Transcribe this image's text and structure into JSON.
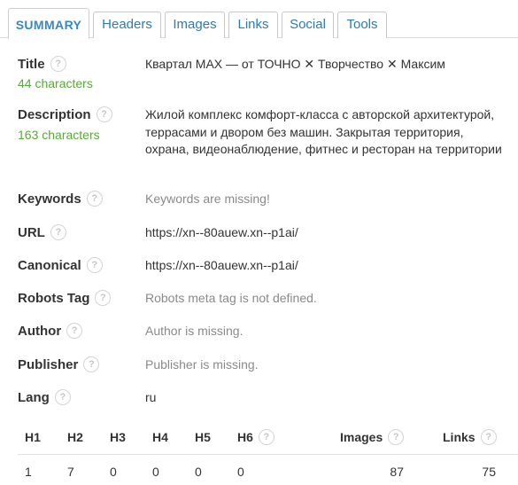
{
  "tabs": [
    {
      "label": "SUMMARY",
      "active": true
    },
    {
      "label": "Headers",
      "active": false
    },
    {
      "label": "Images",
      "active": false
    },
    {
      "label": "Links",
      "active": false
    },
    {
      "label": "Social",
      "active": false
    },
    {
      "label": "Tools",
      "active": false
    }
  ],
  "help_glyph": "?",
  "summary": {
    "title": {
      "label": "Title",
      "count": "44 characters",
      "value": "Квартал MAX — от ТОЧНО ✕ Творчество ✕ Максим"
    },
    "description": {
      "label": "Description",
      "count": "163 characters",
      "value": "Жилой комплекс комфорт-класса с авторской архитектурой, террасами и двором без машин. Закрытая территория, охрана, видеонаблюдение, фитнес и ресторан на территории"
    },
    "keywords": {
      "label": "Keywords",
      "value": "Keywords are missing!"
    },
    "url": {
      "label": "URL",
      "value": "https://xn--80auew.xn--p1ai/"
    },
    "canonical": {
      "label": "Canonical",
      "value": "https://xn--80auew.xn--p1ai/"
    },
    "robots": {
      "label": "Robots Tag",
      "value": "Robots meta tag is not defined."
    },
    "author": {
      "label": "Author",
      "value": "Author is missing."
    },
    "publisher": {
      "label": "Publisher",
      "value": "Publisher is missing."
    },
    "lang": {
      "label": "Lang",
      "value": "ru"
    }
  },
  "stats": {
    "headers": [
      "H1",
      "H2",
      "H3",
      "H4",
      "H5",
      "H6",
      "Images",
      "Links"
    ],
    "values": [
      "1",
      "7",
      "0",
      "0",
      "0",
      "0",
      "87",
      "75"
    ]
  },
  "colors": {
    "accent": "#3a87bf",
    "count_green": "#5aa83a",
    "muted_text": "#8a8a8a"
  }
}
